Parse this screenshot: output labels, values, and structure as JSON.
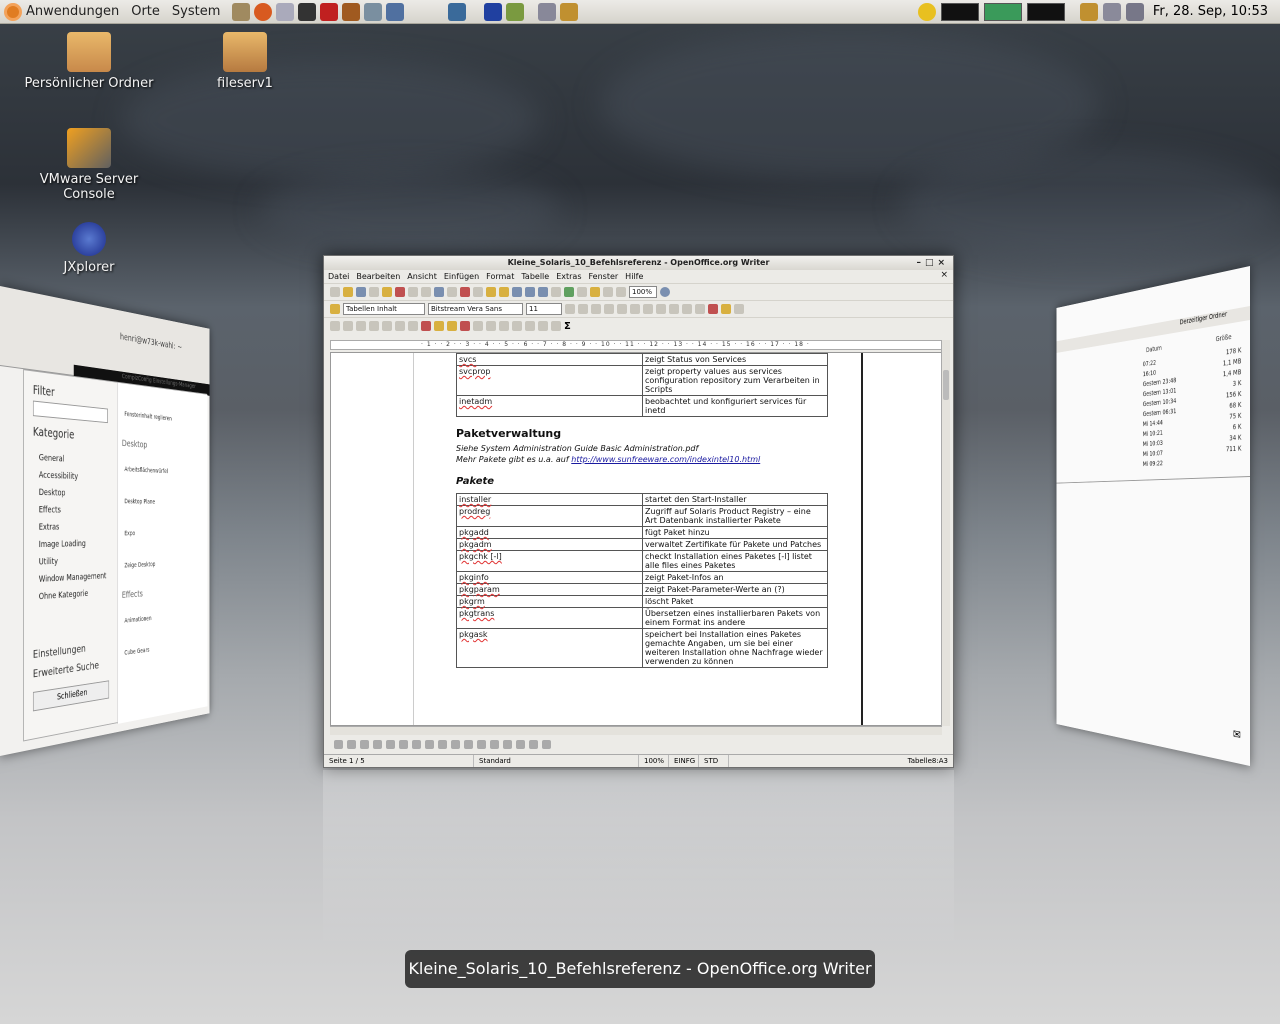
{
  "panel": {
    "menus": [
      "Anwendungen",
      "Orte",
      "System"
    ],
    "clock": "Fr, 28. Sep, 10:53"
  },
  "desktop_icons": [
    {
      "label": "Persönlicher Ordner"
    },
    {
      "label": "fileserv1"
    },
    {
      "label": "VMware Server Console"
    },
    {
      "label": "JXplorer"
    }
  ],
  "left_window": {
    "title": "henri@w73k-wahl: ~",
    "ccsm_title": "CompizConfig Einstellungs-Manager",
    "filter": "Filter",
    "kategorie": "Kategorie",
    "categories": [
      "General",
      "Accessibility",
      "Desktop",
      "Effects",
      "Extras",
      "Image Loading",
      "Utility",
      "Window Management",
      "Ohne Kategorie"
    ],
    "einstellungen": "Einstellungen",
    "erweiterte_suche": "Erweiterte Suche",
    "schliessen": "Schließen",
    "sections": {
      "desktop": "Desktop",
      "effects": "Effects"
    },
    "options": [
      "Fensterinhalt reglieren",
      "Arbeitsflächenwürfel",
      "Desktop Plane",
      "Expo",
      "Zeige Desktop",
      "Animationen",
      "Cube Gears"
    ]
  },
  "right_window": {
    "header": "Derzeitiger Ordner",
    "col_size": "Größe",
    "col_date": "Datum",
    "sizes": [
      "178 K",
      "1,1 MB",
      "1,4 MB",
      "3 K",
      "156 K",
      "68 K",
      "75 K",
      "6 K",
      "34 K",
      "711 K"
    ],
    "dates": [
      "07:22",
      "16:10",
      "Gestern 23:48",
      "Gestern 13:01",
      "Gestern 10:34",
      "Gestern 06:31",
      "Mi 14:44",
      "Mi 10:21",
      "Mi 10:03",
      "Mi 10:07",
      "Mi 09:22"
    ]
  },
  "writer": {
    "title": "Kleine_Solaris_10_Befehlsreferenz - OpenOffice.org Writer",
    "menus": [
      "Datei",
      "Bearbeiten",
      "Ansicht",
      "Einfügen",
      "Format",
      "Tabelle",
      "Extras",
      "Fenster",
      "Hilfe"
    ],
    "style": "Tabellen Inhalt",
    "font": "Bitstream Vera Sans",
    "size": "11",
    "zoom": "100%",
    "ruler": "· 1 · · 2 · · 3 · · 4 · · 5 · · 6 · · 7 · · 8 · · 9 · · 10 · · 11 · · 12 · · 13 · · 14 · · 15 · · 16 · · 17 · · 18 ·",
    "table1": [
      [
        "svcs",
        "zeigt Status von Services"
      ],
      [
        "svcprop",
        "zeigt property values aus services configuration repository zum Verarbeiten in Scripts"
      ],
      [
        "inetadm",
        "beobachtet und konfiguriert services für inetd"
      ]
    ],
    "heading": "Paketverwaltung",
    "line1": "Siehe System Administration Guide Basic Administration.pdf",
    "line2_prefix": "Mehr Pakete gibt es u.a. auf",
    "line2_link": "http://www.sunfreeware.com/indexintel10.html",
    "subheading": "Pakete",
    "table2": [
      [
        "installer",
        "startet den Start-Installer"
      ],
      [
        "prodreg",
        "Zugriff auf Solaris Product Registry – eine Art Datenbank installierter Pakete"
      ],
      [
        "pkgadd",
        "fügt Paket hinzu"
      ],
      [
        "pkgadm",
        "verwaltet Zertifikate für Pakete und Patches"
      ],
      [
        "pkgchk [-l]",
        "checkt Installation eines Paketes [-l] listet alle files eines Paketes"
      ],
      [
        "pkginfo",
        "zeigt Paket-Infos an"
      ],
      [
        "pkgparam",
        "zeigt Paket-Parameter-Werte an (?)"
      ],
      [
        "pkgrm",
        "löscht Paket"
      ],
      [
        "pkgtrans",
        "Übersetzen eines installierbaren Pakets von einem Format ins andere"
      ],
      [
        "pkgask",
        "speichert bei Installation eines Paketes gemachte Angaben, um sie bei einer weiteren Installation ohne Nachfrage wieder verwenden zu können"
      ]
    ],
    "status": {
      "page": "Seite 1 / 5",
      "style": "Standard",
      "zoom": "100%",
      "mode": "EINFG",
      "sel": "STD",
      "cell": "Tabelle8:A3"
    }
  },
  "switcher_caption": "Kleine_Solaris_10_Befehlsreferenz - OpenOffice.org Writer",
  "colors": {
    "panel": "#ecebe7",
    "accent": "#e07c22",
    "link": "#1a1aa0"
  }
}
